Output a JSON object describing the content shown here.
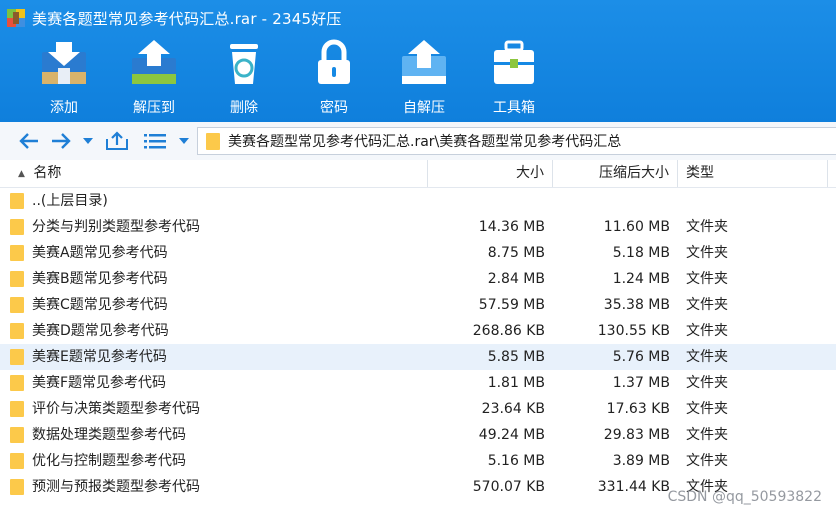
{
  "window": {
    "title": "美赛各题型常见参考代码汇总.rar - 2345好压"
  },
  "toolbar": {
    "items": [
      {
        "label": "添加",
        "icon": "add-archive-icon"
      },
      {
        "label": "解压到",
        "icon": "extract-to-icon"
      },
      {
        "label": "删除",
        "icon": "delete-icon"
      },
      {
        "label": "密码",
        "icon": "lock-icon"
      },
      {
        "label": "自解压",
        "icon": "self-extract-icon"
      },
      {
        "label": "工具箱",
        "icon": "toolbox-icon"
      }
    ]
  },
  "nav": {
    "path": "美赛各题型常见参考代码汇总.rar\\美赛各题型常见参考代码汇总"
  },
  "columns": {
    "name": "名称",
    "size": "大小",
    "compressed": "压缩后大小",
    "type": "类型"
  },
  "rows": [
    {
      "name": "..(上层目录)",
      "size": "",
      "compressed": "",
      "type": ""
    },
    {
      "name": "分类与判别类题型参考代码",
      "size": "14.36 MB",
      "compressed": "11.60 MB",
      "type": "文件夹"
    },
    {
      "name": "美赛A题常见参考代码",
      "size": "8.75 MB",
      "compressed": "5.18 MB",
      "type": "文件夹"
    },
    {
      "name": "美赛B题常见参考代码",
      "size": "2.84 MB",
      "compressed": "1.24 MB",
      "type": "文件夹"
    },
    {
      "name": "美赛C题常见参考代码",
      "size": "57.59 MB",
      "compressed": "35.38 MB",
      "type": "文件夹"
    },
    {
      "name": "美赛D题常见参考代码",
      "size": "268.86 KB",
      "compressed": "130.55 KB",
      "type": "文件夹"
    },
    {
      "name": "美赛E题常见参考代码",
      "size": "5.85 MB",
      "compressed": "5.76 MB",
      "type": "文件夹",
      "selected": true
    },
    {
      "name": "美赛F题常见参考代码",
      "size": "1.81 MB",
      "compressed": "1.37 MB",
      "type": "文件夹"
    },
    {
      "name": "评价与决策类题型参考代码",
      "size": "23.64 KB",
      "compressed": "17.63 KB",
      "type": "文件夹"
    },
    {
      "name": "数据处理类题型参考代码",
      "size": "49.24 MB",
      "compressed": "29.83 MB",
      "type": "文件夹"
    },
    {
      "name": "优化与控制题型参考代码",
      "size": "5.16 MB",
      "compressed": "3.89 MB",
      "type": "文件夹"
    },
    {
      "name": "预测与预报类题型参考代码",
      "size": "570.07 KB",
      "compressed": "331.44 KB",
      "type": "文件夹"
    }
  ],
  "watermark": "CSDN @qq_50593822",
  "colors": {
    "accent": "#1689e4",
    "folder": "#fcc94a",
    "selected_row": "#e8f1fb"
  }
}
